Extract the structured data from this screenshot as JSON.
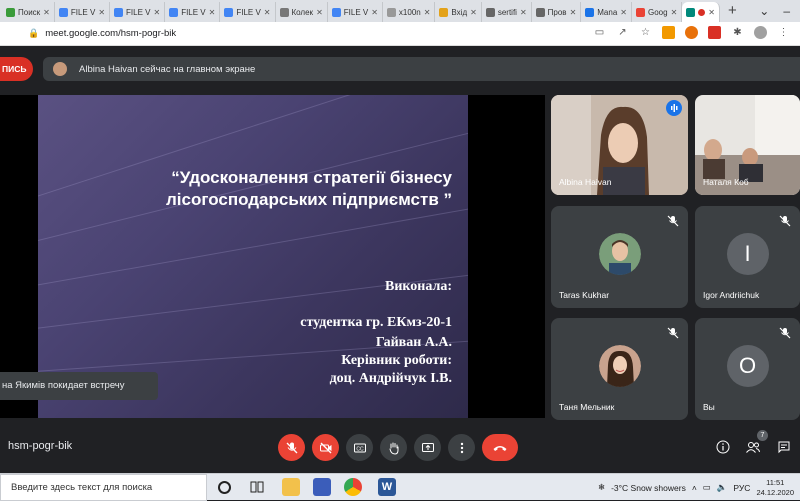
{
  "browser": {
    "tabs": [
      {
        "label": "Поиск",
        "fav": "#3a9b3a"
      },
      {
        "label": "FILE V",
        "fav": "#4285f4"
      },
      {
        "label": "FILE V",
        "fav": "#4285f4"
      },
      {
        "label": "FILE V",
        "fav": "#4285f4"
      },
      {
        "label": "FILE V",
        "fav": "#4285f4"
      },
      {
        "label": "Колек",
        "fav": "#777777"
      },
      {
        "label": "FILE V",
        "fav": "#4285f4"
      },
      {
        "label": "x100n",
        "fav": "#999999"
      },
      {
        "label": "Вхід",
        "fav": "#e3a21a"
      },
      {
        "label": "sertifi",
        "fav": "#666666"
      },
      {
        "label": "Пров",
        "fav": "#666666"
      },
      {
        "label": "Manа",
        "fav": "#1a73e8"
      },
      {
        "label": "Goog",
        "fav": "#ea4335"
      },
      {
        "label": "",
        "fav": "#00897b",
        "active": true
      }
    ],
    "url": "meet.google.com/hsm-pogr-bik"
  },
  "meet": {
    "rec_label": "ПИСЬ",
    "presenting_text": "Albina Haivan сейчас на главном экране",
    "leave_toast": "на Якимів покидает встречу",
    "meeting_code": "hsm-pogr-bik",
    "participant_count": "7"
  },
  "slide": {
    "title_line1": "“Удосконалення стратегії бізнесу",
    "title_line2": "лісогосподарських підприємств ”",
    "vykonala": "Виконала:",
    "student": "студентка гр. ЕКмз-20-1",
    "student_name": "Гайван А.А.",
    "supervisor_label": "Керівник роботи:",
    "supervisor_name": "доц. Андрійчук І.В."
  },
  "participants": [
    {
      "name": "Albina Haivan",
      "type": "video-woman",
      "speaking": true
    },
    {
      "name": "Наталя Коб",
      "type": "video-room"
    },
    {
      "name": "Taras Kukhar",
      "type": "photo-man",
      "muted": true
    },
    {
      "name": "Igor Andriichuk",
      "type": "letter",
      "letter": "I",
      "muted": true
    },
    {
      "name": "Таня Мельник",
      "type": "photo-woman",
      "muted": true
    },
    {
      "name": "Вы",
      "type": "letter",
      "letter": "O",
      "muted": true
    }
  ],
  "taskbar": {
    "search_placeholder": "Введите здесь текст для поиска",
    "weather": "-3°C  Snow showers",
    "lang": "РУС",
    "time": "11:51",
    "date": "24.12.2020"
  },
  "colors": {
    "meet_bg": "#202124",
    "tile_bg": "#3c4043",
    "danger": "#ea4335",
    "accent": "#1a73e8"
  }
}
